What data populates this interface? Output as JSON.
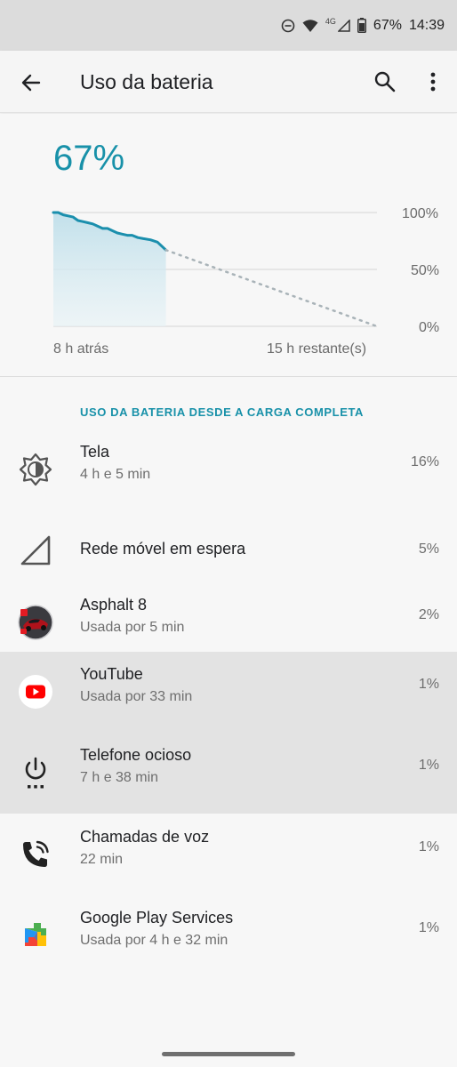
{
  "status_bar": {
    "network": "4G",
    "battery": "67%",
    "time": "14:39"
  },
  "app_bar": {
    "title": "Uso da bateria"
  },
  "summary": {
    "level": "67%",
    "y_labels": [
      "100%",
      "50%",
      "0%"
    ],
    "start_label": "8 h atrás",
    "end_label": "15 h restante(s)"
  },
  "chart_data": {
    "type": "area",
    "title": "",
    "xlabel": "",
    "ylabel": "",
    "ylim": [
      0,
      100
    ],
    "x_start": "8 h atrás",
    "x_end": "15 h restante(s)",
    "x_total_hours": 23,
    "grid": true,
    "series": [
      {
        "x_hours": [
          0,
          0.35,
          0.7,
          1.05,
          1.4,
          1.75,
          2.1,
          2.45,
          2.8,
          3.15,
          3.5,
          3.85,
          4.2,
          4.55,
          4.9,
          5.25,
          5.6,
          6.0,
          6.4,
          6.9,
          7.4,
          8.0
        ],
        "values": [
          100,
          100,
          98,
          97,
          96,
          93,
          92,
          91,
          90,
          88,
          86,
          86,
          84,
          82,
          81,
          80,
          80,
          78,
          77,
          76,
          74,
          67
        ]
      },
      {
        "x_hours": [
          8.0,
          23
        ],
        "values": [
          67,
          0
        ]
      }
    ]
  },
  "list": {
    "header": "USO DA BATERIA DESDE A CARGA COMPLETA",
    "items": [
      {
        "name": "Tela",
        "sub": "4 h e 5 min",
        "pct": "16%",
        "icon": "brightness-icon"
      },
      {
        "name": "Rede móvel em espera",
        "sub": "",
        "pct": "5%",
        "icon": "cell-signal-icon"
      },
      {
        "name": "Asphalt 8",
        "sub": "Usada por 5 min",
        "pct": "2%",
        "icon": "asphalt-app-icon"
      },
      {
        "name": "YouTube",
        "sub": "Usada por 33 min",
        "pct": "1%",
        "icon": "youtube-app-icon"
      },
      {
        "name": "Telefone ocioso",
        "sub": "7 h e 38 min",
        "pct": "1%",
        "icon": "power-icon"
      },
      {
        "name": "Chamadas de voz",
        "sub": "22 min",
        "pct": "1%",
        "icon": "phone-call-icon"
      },
      {
        "name": "Google Play Services",
        "sub": "Usada por 4 h e 32 min",
        "pct": "1%",
        "icon": "play-services-icon"
      }
    ]
  },
  "colors": {
    "accent": "#1891a9",
    "chart_line": "#1b8fad",
    "chart_fill": "#cfe6ef",
    "highlight_row": "#e3e3e3",
    "youtube_red": "#ff0000"
  }
}
